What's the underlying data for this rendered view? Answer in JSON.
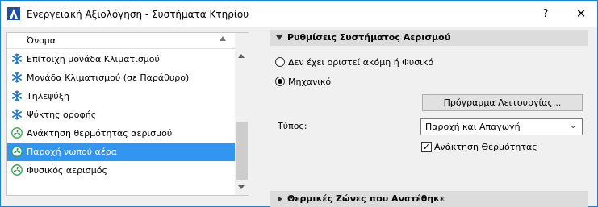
{
  "window": {
    "title": "Ενεργειακή Αξιολόγηση - Συστήματα Κτηρίου",
    "help_glyph": "?",
    "close_glyph": "✕"
  },
  "list": {
    "header_label": "Όνομα",
    "items": [
      {
        "label": "Επίτοιχη μονάδα Κλιματισμού",
        "icon": "snowflake-icon",
        "selected": false
      },
      {
        "label": "Μονάδα Κλιματισμού (σε Παράθυρο)",
        "icon": "snowflake-icon",
        "selected": false
      },
      {
        "label": "Τηλεψύξη",
        "icon": "snowflake-icon",
        "selected": false
      },
      {
        "label": "Ψύκτης οροφής",
        "icon": "snowflake-icon",
        "selected": false
      },
      {
        "label": "Ανάκτηση θερμότητας αερισμού",
        "icon": "fan-icon",
        "selected": false
      },
      {
        "label": "Παροχή νωπού αέρα",
        "icon": "fan-icon",
        "selected": true
      },
      {
        "label": "Φυσικός αερισμός",
        "icon": "fan-icon",
        "selected": false
      }
    ]
  },
  "settings": {
    "ventilation_header": "Ρυθμίσεις Συστήματος Αερισμού",
    "radio_natural": "Δεν έχει οριστεί ακόμη ή Φυσικό",
    "radio_mechanical": "Μηχανικό",
    "schedule_button": "Πρόγραμμα Λειτουργίας...",
    "type_label": "Τύπος:",
    "type_value": "Παροχή και Απαγωγή",
    "heat_recovery_label": "Ανάκτηση Θερμότητας",
    "heat_recovery_checked": true,
    "zones_header": "Θερμικές Ζώνες που Ανατέθηκε"
  },
  "colors": {
    "snowflake": "#1e78d2",
    "fan": "#2aa24a",
    "selection": "#3296f0"
  }
}
